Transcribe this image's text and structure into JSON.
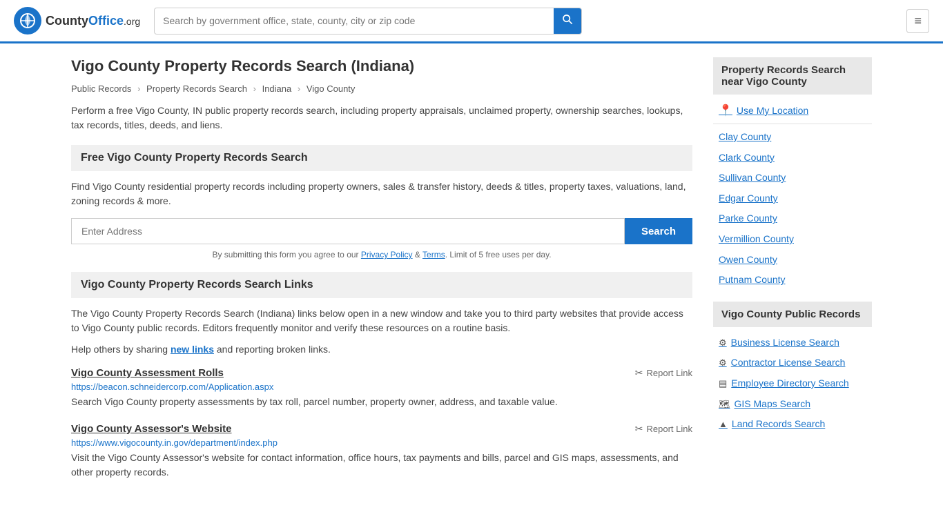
{
  "header": {
    "logo_text": "CountyOffice",
    "logo_tld": ".org",
    "search_placeholder": "Search by government office, state, county, city or zip code"
  },
  "page": {
    "title": "Vigo County Property Records Search (Indiana)",
    "breadcrumbs": [
      {
        "label": "Public Records",
        "href": "#"
      },
      {
        "label": "Property Records Search",
        "href": "#"
      },
      {
        "label": "Indiana",
        "href": "#"
      },
      {
        "label": "Vigo County",
        "href": "#"
      }
    ],
    "description": "Perform a free Vigo County, IN public property records search, including property appraisals, unclaimed property, ownership searches, lookups, tax records, titles, deeds, and liens.",
    "free_search_section": {
      "heading": "Free Vigo County Property Records Search",
      "description": "Find Vigo County residential property records including property owners, sales & transfer history, deeds & titles, property taxes, valuations, land, zoning records & more.",
      "input_placeholder": "Enter Address",
      "search_button": "Search",
      "disclaimer_before": "By submitting this form you agree to our ",
      "privacy_label": "Privacy Policy",
      "and_text": " & ",
      "terms_label": "Terms",
      "disclaimer_after": ". Limit of 5 free uses per day."
    },
    "links_section": {
      "heading": "Vigo County Property Records Search Links",
      "description": "The Vigo County Property Records Search (Indiana) links below open in a new window and take you to third party websites that provide access to Vigo County public records. Editors frequently monitor and verify these resources on a routine basis.",
      "share_text": "Help others by sharing ",
      "new_links_label": "new links",
      "share_text2": " and reporting broken links.",
      "links": [
        {
          "title": "Vigo County Assessment Rolls",
          "url": "https://beacon.schneidercorp.com/Application.aspx",
          "description": "Search Vigo County property assessments by tax roll, parcel number, property owner, address, and taxable value.",
          "report_label": "Report Link"
        },
        {
          "title": "Vigo County Assessor's Website",
          "url": "https://www.vigocounty.in.gov/department/index.php",
          "description": "Visit the Vigo County Assessor's website for contact information, office hours, tax payments and bills, parcel and GIS maps, assessments, and other property records.",
          "report_label": "Report Link"
        }
      ]
    }
  },
  "sidebar": {
    "nearby_section": {
      "title": "Property Records Search near Vigo County",
      "use_location_label": "Use My Location",
      "counties": [
        "Clay County",
        "Clark County",
        "Sullivan County",
        "Edgar County",
        "Parke County",
        "Vermillion County",
        "Owen County",
        "Putnam County"
      ]
    },
    "public_records_section": {
      "title": "Vigo County Public Records",
      "links": [
        {
          "icon": "⚙",
          "label": "Business License Search"
        },
        {
          "icon": "⚙",
          "label": "Contractor License Search"
        },
        {
          "icon": "▤",
          "label": "Employee Directory Search"
        },
        {
          "icon": "🗺",
          "label": "GIS Maps Search"
        },
        {
          "icon": "▲",
          "label": "Land Records Search"
        }
      ]
    }
  }
}
